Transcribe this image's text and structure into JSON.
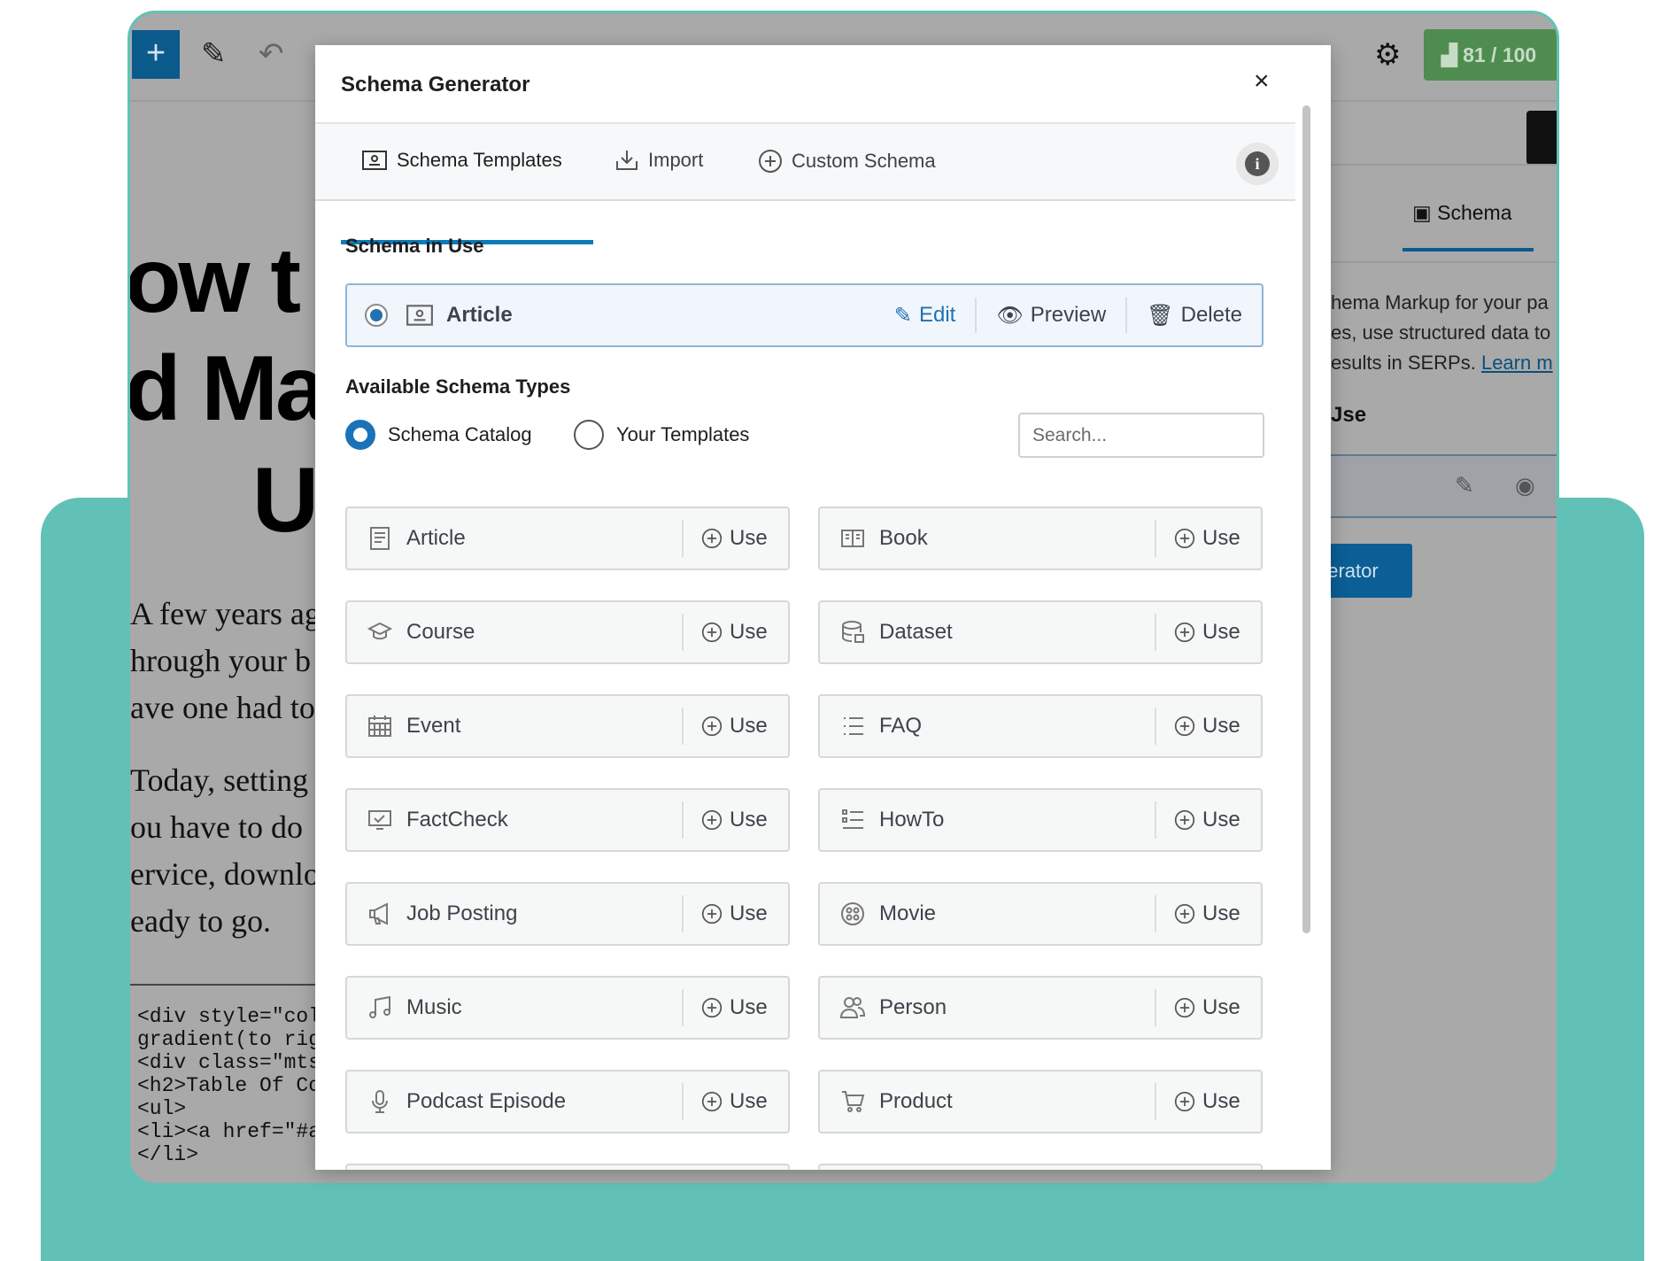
{
  "editor": {
    "score_label": "81 / 100",
    "title_lines": [
      "ow t",
      "d Ma",
      "U"
    ],
    "paragraph1": [
      "A few years ago",
      "hrough your b",
      "ave one had to"
    ],
    "paragraph2": [
      "Today, setting u",
      "ou have to do",
      "ervice, downlo",
      "eady to go."
    ],
    "code_lines": [
      "<div style=\"col",
      "gradient(to rig",
      "<div class=\"mts",
      "<h2>Table Of Co",
      "<ul>",
      "<li><a href=\"#a",
      "</li>"
    ]
  },
  "right_panel": {
    "tab_label": "Schema",
    "text_lines": [
      "hema Markup for your pa",
      "es, use structured data to",
      "esults in SERPs. "
    ],
    "learn_more": "Learn m",
    "in_use_heading": "Jse",
    "generator_button": "nerator"
  },
  "modal": {
    "title": "Schema Generator",
    "close_label": "×",
    "tabs": [
      {
        "label": "Schema Templates",
        "icon": "schema-template-icon",
        "active": true
      },
      {
        "label": "Import",
        "icon": "import-icon",
        "active": false
      },
      {
        "label": "Custom Schema",
        "icon": "plus-circle-icon",
        "active": false
      }
    ],
    "info_label": "i",
    "schema_in_use_heading": "Schema in Use",
    "in_use": {
      "name": "Article",
      "edit": "Edit",
      "preview": "Preview",
      "delete": "Delete"
    },
    "available_heading": "Available Schema Types",
    "sources": [
      {
        "label": "Schema Catalog",
        "selected": true
      },
      {
        "label": "Your Templates",
        "selected": false
      }
    ],
    "search_placeholder": "Search...",
    "use_label": "Use",
    "schema_types": [
      {
        "label": "Article",
        "icon": "article-icon"
      },
      {
        "label": "Book",
        "icon": "book-icon"
      },
      {
        "label": "Course",
        "icon": "graduation-cap-icon"
      },
      {
        "label": "Dataset",
        "icon": "database-icon"
      },
      {
        "label": "Event",
        "icon": "calendar-icon"
      },
      {
        "label": "FAQ",
        "icon": "list-icon"
      },
      {
        "label": "FactCheck",
        "icon": "check-monitor-icon"
      },
      {
        "label": "HowTo",
        "icon": "steps-list-icon"
      },
      {
        "label": "Job Posting",
        "icon": "megaphone-icon"
      },
      {
        "label": "Movie",
        "icon": "film-reel-icon"
      },
      {
        "label": "Music",
        "icon": "music-note-icon"
      },
      {
        "label": "Person",
        "icon": "people-icon"
      },
      {
        "label": "Podcast Episode",
        "icon": "microphone-icon"
      },
      {
        "label": "Product",
        "icon": "cart-icon"
      }
    ],
    "colors": {
      "accent": "#2271b1",
      "tab_underline": "#0a7bb8",
      "score_green": "#4f8c50",
      "teal_background": "#62c1b6"
    }
  }
}
